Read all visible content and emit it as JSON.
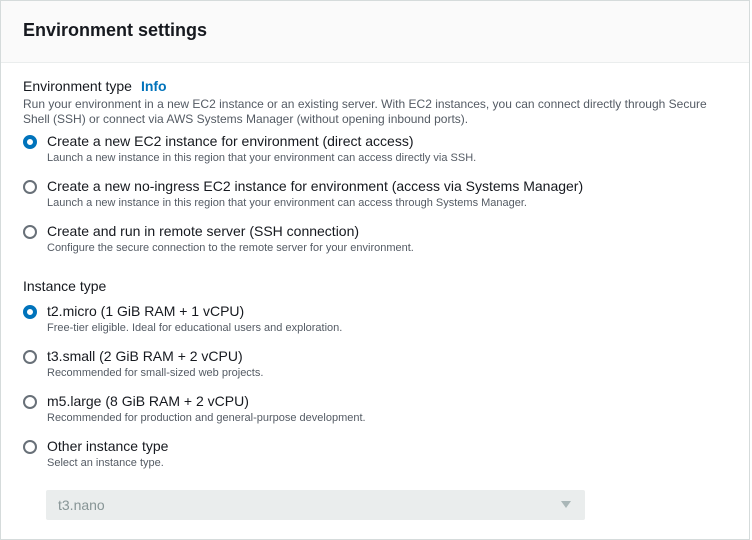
{
  "panel": {
    "title": "Environment settings"
  },
  "environment_type": {
    "label": "Environment type",
    "info_link": "Info",
    "description": "Run your environment in a new EC2 instance or an existing server. With EC2 instances, you can connect directly through Secure Shell (SSH) or connect via AWS Systems Manager (without opening inbound ports).",
    "options": [
      {
        "label": "Create a new EC2 instance for environment (direct access)",
        "description": "Launch a new instance in this region that your environment can access directly via SSH.",
        "selected": true
      },
      {
        "label": "Create a new no-ingress EC2 instance for environment (access via Systems Manager)",
        "description": "Launch a new instance in this region that your environment can access through Systems Manager.",
        "selected": false
      },
      {
        "label": "Create and run in remote server (SSH connection)",
        "description": "Configure the secure connection to the remote server for your environment.",
        "selected": false
      }
    ]
  },
  "instance_type": {
    "label": "Instance type",
    "options": [
      {
        "label": "t2.micro (1 GiB RAM + 1 vCPU)",
        "description": "Free-tier eligible. Ideal for educational users and exploration.",
        "selected": true
      },
      {
        "label": "t3.small (2 GiB RAM + 2 vCPU)",
        "description": "Recommended for small-sized web projects.",
        "selected": false
      },
      {
        "label": "m5.large (8 GiB RAM + 2 vCPU)",
        "description": "Recommended for production and general-purpose development.",
        "selected": false
      },
      {
        "label": "Other instance type",
        "description": "Select an instance type.",
        "selected": false
      }
    ],
    "other_select": {
      "value": "t3.nano",
      "disabled": true
    }
  },
  "icons": {
    "select_caret": "caret-down-icon"
  },
  "colors": {
    "accent": "#0073bb",
    "text": "#16191f",
    "secondary_text": "#545b64",
    "disabled_bg": "#eaeded"
  }
}
